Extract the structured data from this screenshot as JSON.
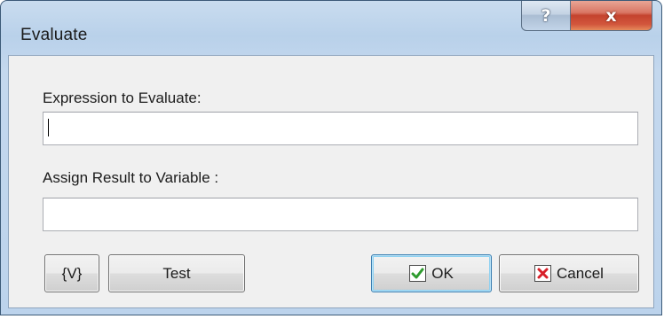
{
  "window": {
    "title": "Evaluate",
    "help_glyph": "?",
    "close_glyph": "x"
  },
  "form": {
    "expression": {
      "label": "Expression to Evaluate:",
      "value": ""
    },
    "result_variable": {
      "label": "Assign Result to Variable :",
      "value": ""
    }
  },
  "buttons": {
    "variable_label": "{V}",
    "test_label": "Test",
    "ok_label": "OK",
    "cancel_label": "Cancel"
  },
  "icons": {
    "ok": "green-checkmark-icon",
    "cancel": "red-x-icon"
  },
  "colors": {
    "ok_icon": "#2e9b2e",
    "cancel_icon": "#d8202a",
    "close_button": "#c4432e"
  }
}
